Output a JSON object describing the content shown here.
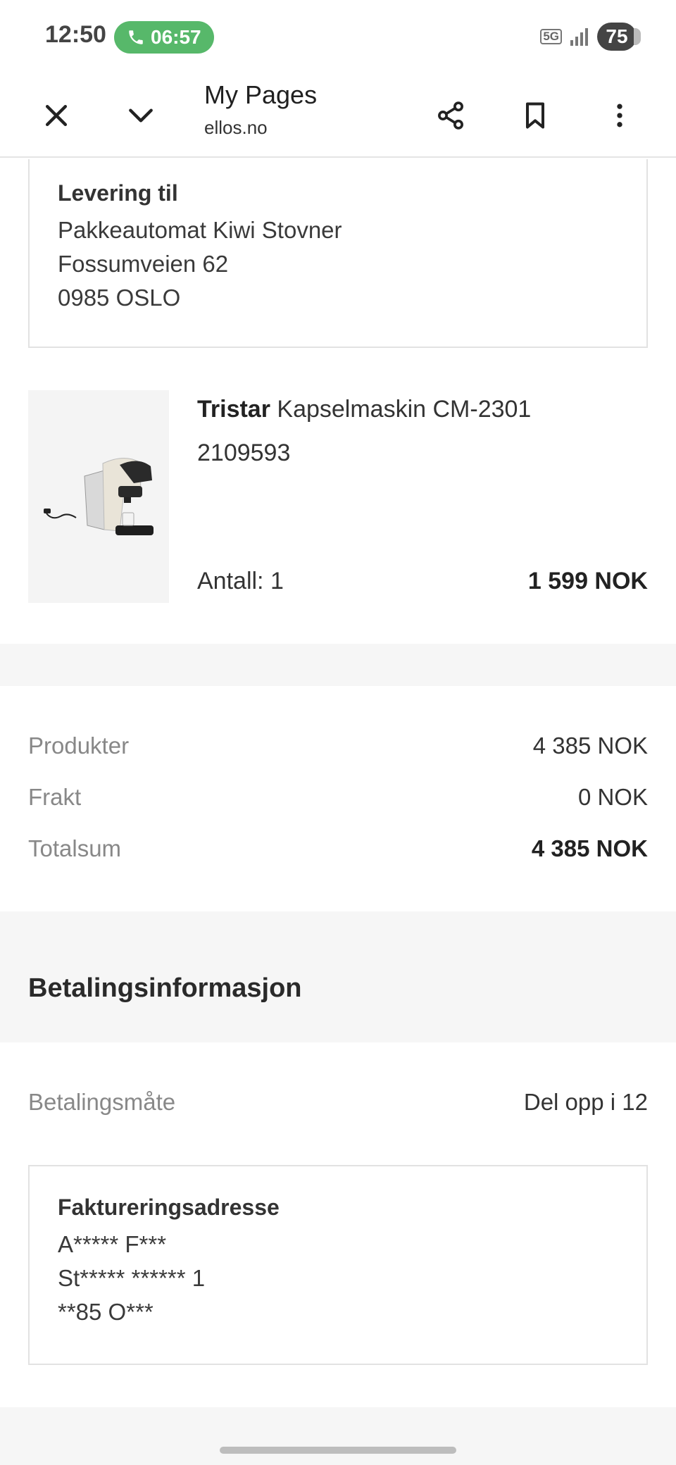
{
  "status_bar": {
    "time": "12:50",
    "call_timer": "06:57",
    "network": "5G",
    "battery": "75"
  },
  "toolbar": {
    "title": "My Pages",
    "url": "ellos.no",
    "icons": [
      "close-icon",
      "chevron-down-icon",
      "share-icon",
      "bookmark-icon",
      "more-vert-icon"
    ]
  },
  "delivery": {
    "title": "Levering til",
    "line1": "Pakkeautomat Kiwi Stovner",
    "line2": "Fossumveien 62",
    "line3": "0985 OSLO"
  },
  "product": {
    "brand": "Tristar",
    "name": " Kapselmaskin CM-2301",
    "sku": "2109593",
    "quantity": "Antall: 1",
    "price": "1 599 NOK"
  },
  "summary": {
    "products_label": "Produkter",
    "products_value": "4 385 NOK",
    "shipping_label": "Frakt",
    "shipping_value": "0 NOK",
    "total_label": "Totalsum",
    "total_value": "4 385 NOK"
  },
  "payment": {
    "section_title": "Betalingsinformasjon",
    "method_label": "Betalingsmåte",
    "method_value": "Del opp i 12"
  },
  "billing": {
    "title": "Faktureringsadresse",
    "line1": "A***** F***",
    "line2": "St***** ****** 1",
    "line3": "**85 O***"
  },
  "colors": {
    "call_pill": "#57b86a",
    "band_gray": "#f6f6f6",
    "border": "#e2e2e2"
  }
}
